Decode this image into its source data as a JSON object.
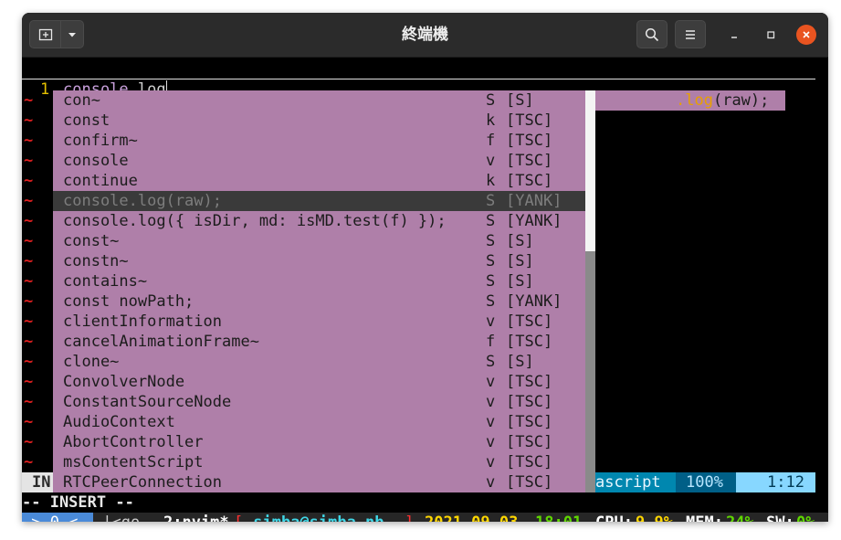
{
  "window": {
    "title": "終端機",
    "new_tab_icon": "new-tab-icon",
    "dropdown_icon": "chevron-down-icon",
    "search_icon": "search-icon",
    "menu_icon": "hamburger-menu-icon",
    "minimize_icon": "minimize-icon",
    "maximize_icon": "maximize-icon",
    "close_icon": "close-icon",
    "close_color": "#e95420"
  },
  "editor": {
    "line_number": "1",
    "line_text_keyword": "console",
    "line_text_rest": ".log",
    "tilde": "~",
    "virtual_text_prefix": ".",
    "virtual_text_fn": "log",
    "virtual_text_args": "(raw);",
    "mode_message": "-- INSERT --",
    "statusline": {
      "mode_fragment": "IN",
      "filetype_fragment": "ascript",
      "percent": "100%",
      "position": "1:12"
    }
  },
  "completion": {
    "selected_index": 5,
    "items": [
      {
        "word": "con~",
        "kind": "S",
        "menu": "[S]"
      },
      {
        "word": "const",
        "kind": "k",
        "menu": "[TSC]"
      },
      {
        "word": "confirm~",
        "kind": "f",
        "menu": "[TSC]"
      },
      {
        "word": "console",
        "kind": "v",
        "menu": "[TSC]"
      },
      {
        "word": "continue",
        "kind": "k",
        "menu": "[TSC]"
      },
      {
        "word": "console.log(raw);",
        "kind": "S",
        "menu": "[YANK]"
      },
      {
        "word": "console.log({ isDir, md: isMD.test(f) });",
        "kind": "S",
        "menu": "[YANK]"
      },
      {
        "word": "const~",
        "kind": "S",
        "menu": "[S]"
      },
      {
        "word": "constn~",
        "kind": "S",
        "menu": "[S]"
      },
      {
        "word": "contains~",
        "kind": "S",
        "menu": "[S]"
      },
      {
        "word": "const nowPath;",
        "kind": "S",
        "menu": "[YANK]"
      },
      {
        "word": "clientInformation",
        "kind": "v",
        "menu": "[TSC]"
      },
      {
        "word": "cancelAnimationFrame~",
        "kind": "f",
        "menu": "[TSC]"
      },
      {
        "word": "clone~",
        "kind": "S",
        "menu": "[S]"
      },
      {
        "word": "ConvolverNode",
        "kind": "v",
        "menu": "[TSC]"
      },
      {
        "word": "ConstantSourceNode",
        "kind": "v",
        "menu": "[TSC]"
      },
      {
        "word": "AudioContext",
        "kind": "v",
        "menu": "[TSC]"
      },
      {
        "word": "AbortController",
        "kind": "v",
        "menu": "[TSC]"
      },
      {
        "word": "msContentScript",
        "kind": "v",
        "menu": "[TSC]"
      },
      {
        "word": "RTCPeerConnection",
        "kind": "v",
        "menu": "[TSC]"
      }
    ],
    "scroll_fraction": 0.4
  },
  "tmux": {
    "nav": " > 0 < ",
    "prefix": " |<go ",
    "window": "2:nvim*",
    "bracket_open": "[",
    "session": " simba@simba-nb ",
    "bracket_close": "]",
    "date": "2021.09.03",
    "time": "18:01",
    "cpu_label": "CPU:",
    "cpu_value": "9.9%",
    "mem_label": "MEM:",
    "mem_value": "24%",
    "sw_label": "SW:",
    "sw_value": "0%"
  },
  "colors": {
    "popup_bg": "#af7fa9",
    "popup_sel_bg": "#3a3a3a",
    "tilde": "#e02020",
    "line_number": "#e5c100",
    "keyword": "#c9a0dc",
    "status_blue": "#0087af",
    "status_cyan": "#87d7ff",
    "tmux_green": "#5fd700",
    "tmux_yellow": "#ffd700",
    "tmux_red": "#ff3030"
  }
}
